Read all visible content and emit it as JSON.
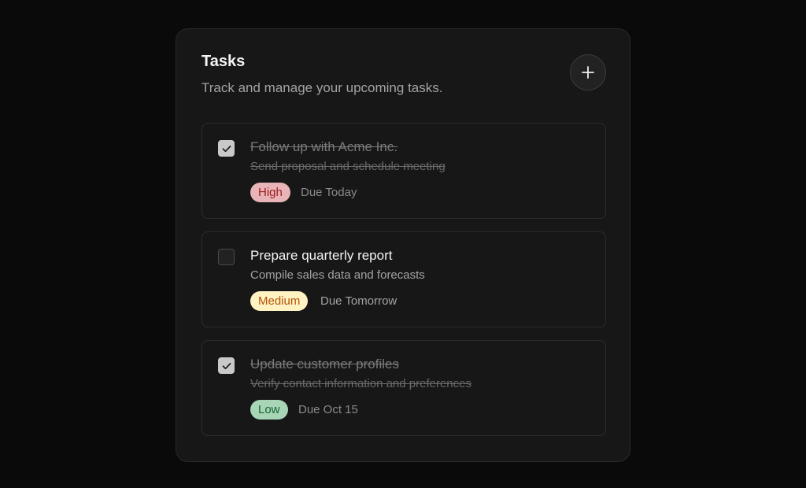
{
  "header": {
    "title": "Tasks",
    "subtitle": "Track and manage your upcoming tasks."
  },
  "add_button": {
    "icon": "plus-icon"
  },
  "tasks": [
    {
      "title": "Follow up with Acme Inc.",
      "description": "Send proposal and schedule meeting",
      "priority": "High",
      "due": "Due Today",
      "completed": true,
      "badge_bg": "#e8b4b8",
      "badge_fg": "#9b1c1c"
    },
    {
      "title": "Prepare quarterly report",
      "description": "Compile sales data and forecasts",
      "priority": "Medium",
      "due": "Due Tomorrow",
      "completed": false,
      "badge_bg": "#fff3c4",
      "badge_fg": "#b45309"
    },
    {
      "title": "Update customer profiles",
      "description": "Verify contact information and preferences",
      "priority": "Low",
      "due": "Due Oct 15",
      "completed": true,
      "badge_bg": "#a8d5b5",
      "badge_fg": "#166534"
    }
  ]
}
